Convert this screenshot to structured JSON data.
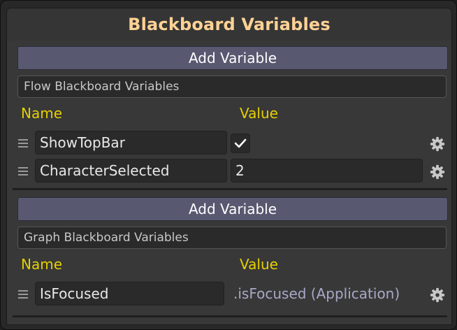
{
  "header": {
    "title": "Blackboard Variables"
  },
  "flow": {
    "add_label": "Add Variable",
    "section_label": "Flow Blackboard Variables",
    "name_header": "Name",
    "value_header": "Value",
    "rows": [
      {
        "name": "ShowTopBar",
        "value_checked": true
      },
      {
        "name": "CharacterSelected",
        "value": "2"
      }
    ]
  },
  "graph": {
    "add_label": "Add Variable",
    "section_label": "Graph Blackboard Variables",
    "name_header": "Name",
    "value_header": "Value",
    "rows": [
      {
        "name": "IsFocused",
        "value": ".isFocused (Application)"
      }
    ]
  },
  "icons": {
    "handle": "drag-handle-icon",
    "options": "gear-icon",
    "check": "checkmark-icon"
  },
  "colors": {
    "title": "#ffd296",
    "header_text": "#e6d000",
    "add_button": "#585870",
    "bound_value": "#a8a8c8"
  }
}
